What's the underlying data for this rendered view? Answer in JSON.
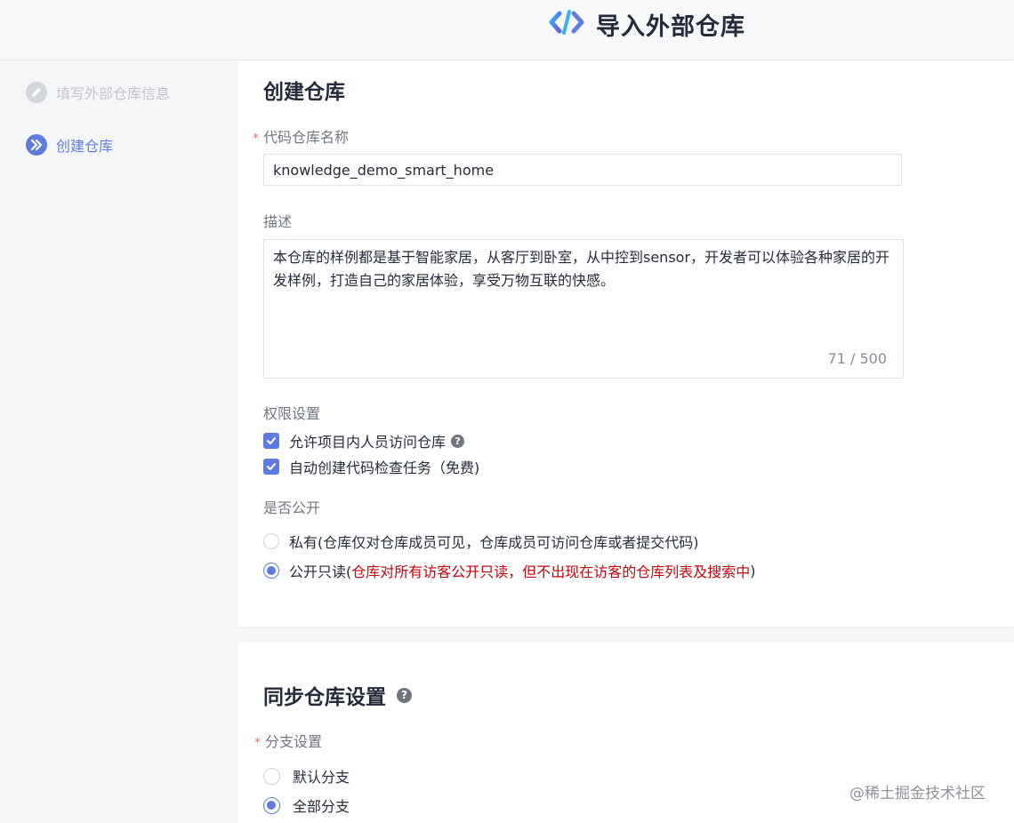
{
  "header": {
    "title": "导入外部仓库",
    "logo_icon": "code-logo-icon"
  },
  "sidebar": {
    "steps": [
      {
        "label": "填写外部仓库信息",
        "icon": "pencil-icon",
        "state": "done"
      },
      {
        "label": "创建仓库",
        "icon": "double-chevron-right-icon",
        "state": "active"
      }
    ]
  },
  "create": {
    "title": "创建仓库",
    "name_label": "代码仓库名称",
    "name_required": "*",
    "name_value": "knowledge_demo_smart_home",
    "desc_label": "描述",
    "desc_value": "本仓库的样例都是基于智能家居，从客厅到卧室，从中控到sensor，开发者可以体验各种家居的开发样例，打造自己的家居体验，享受万物互联的快感。",
    "desc_counter": "71 / 500",
    "perm_label": "权限设置",
    "perm_options": [
      {
        "label": "允许项目内人员访问仓库",
        "checked": true,
        "help_icon": "question-icon"
      },
      {
        "label": "自动创建代码检查任务（免费)",
        "checked": true
      }
    ],
    "public_label": "是否公开",
    "public_options": [
      {
        "label": "私有(仓库仅对仓库成员可见，仓库成员可访问仓库或者提交代码)",
        "selected": false
      },
      {
        "label": "公开只读(",
        "note": "仓库对所有访客公开只读，但不出现在访客的仓库列表及搜索中",
        "suffix": " )",
        "selected": true
      }
    ]
  },
  "sync": {
    "title": "同步仓库设置",
    "branch_label": "分支设置",
    "branch_required": "*",
    "branch_options": [
      {
        "label": "默认分支",
        "selected": false
      },
      {
        "label": "全部分支",
        "selected": true
      }
    ]
  },
  "watermark": "@稀土掘金技术社区",
  "colors": {
    "accent": "#5e7ce0",
    "warning_text": "#c7000b",
    "required": "#f66f6a"
  }
}
